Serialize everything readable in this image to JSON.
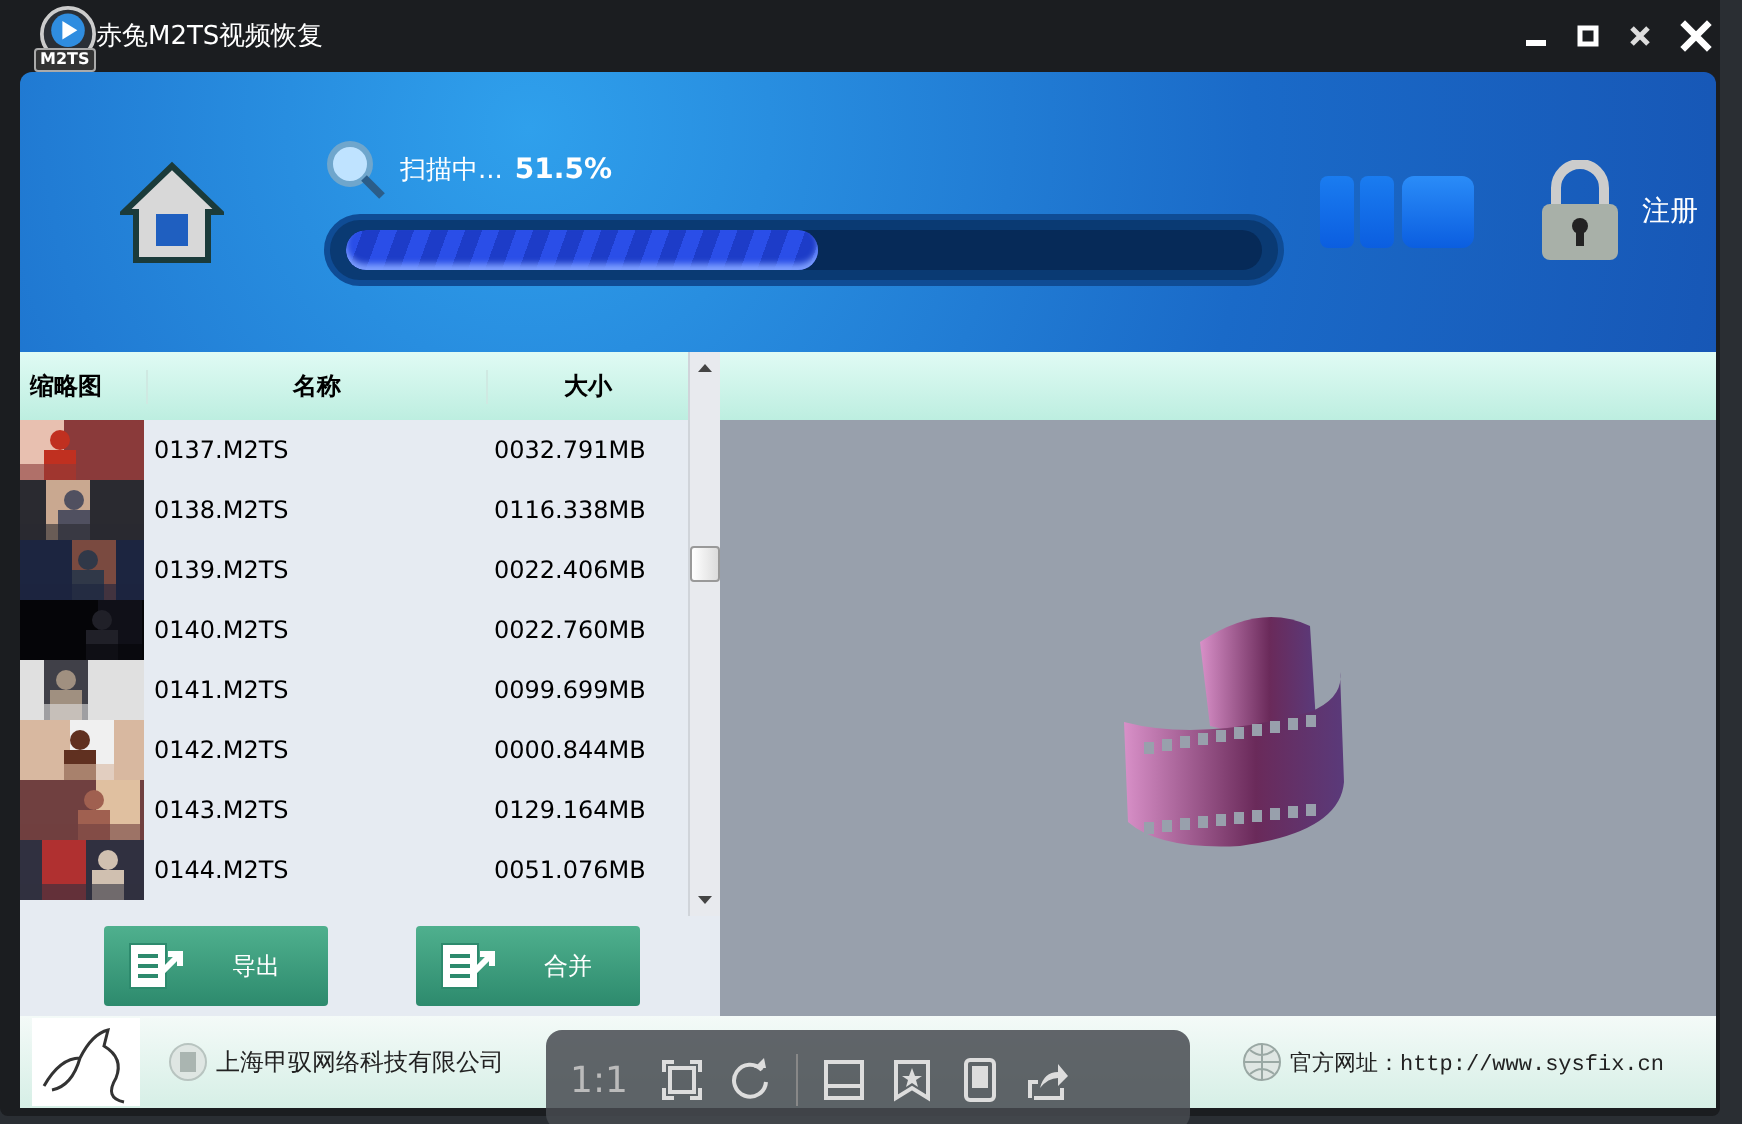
{
  "window": {
    "title": "赤兔M2TS视频恢复",
    "app_badge": "M2TS"
  },
  "scan": {
    "status": "扫描中...",
    "percent": "51.5%",
    "level": 0.515
  },
  "register": {
    "label": "注册"
  },
  "table": {
    "columns": [
      "缩略图",
      "名称",
      "大小"
    ],
    "rows": [
      {
        "name": "0137.M2TS",
        "size": "0032.791MB"
      },
      {
        "name": "0138.M2TS",
        "size": "0116.338MB"
      },
      {
        "name": "0139.M2TS",
        "size": "0022.406MB"
      },
      {
        "name": "0140.M2TS",
        "size": "0022.760MB"
      },
      {
        "name": "0141.M2TS",
        "size": "0099.699MB"
      },
      {
        "name": "0142.M2TS",
        "size": "0000.844MB"
      },
      {
        "name": "0143.M2TS",
        "size": "0129.164MB"
      },
      {
        "name": "0144.M2TS",
        "size": "0051.076MB"
      }
    ]
  },
  "buttons": [
    "导出",
    "合并"
  ],
  "footer": {
    "company": "上海甲驭网络科技有限公司",
    "website": "官方网址：http://www.sysfix.cn"
  },
  "viewer_toolbar": {
    "zoom_label": "1:1"
  }
}
